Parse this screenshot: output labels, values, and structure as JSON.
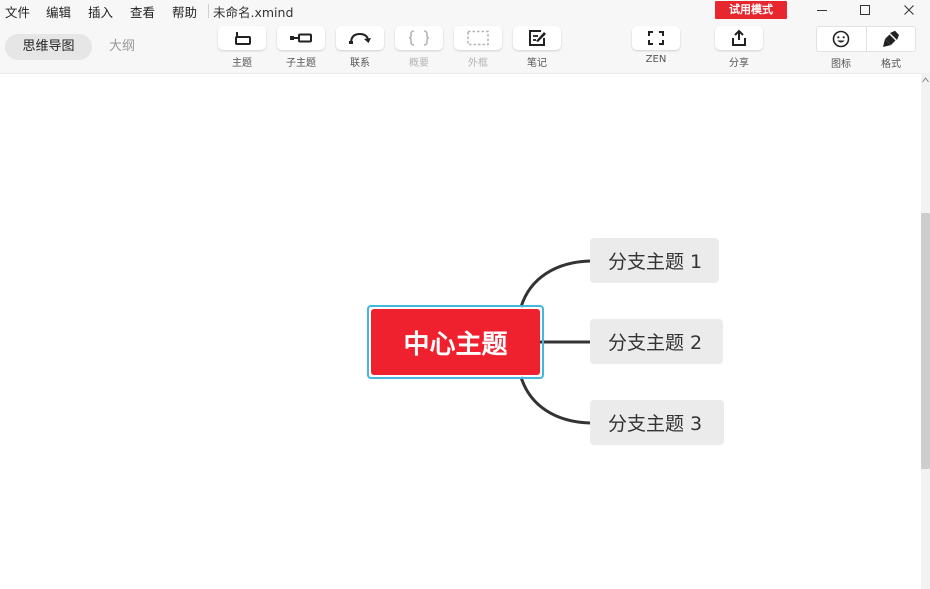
{
  "menu": [
    "文件",
    "编辑",
    "插入",
    "查看",
    "帮助"
  ],
  "file_name": "未命名.xmind",
  "trial_badge": "试用模式",
  "view_tabs": {
    "mindmap": "思维导图",
    "outline": "大纲"
  },
  "toolbar": {
    "topic": "主题",
    "subtopic": "子主题",
    "relationship": "联系",
    "summary": "概要",
    "boundary": "外框",
    "notes": "笔记",
    "zen": "ZEN",
    "share": "分享",
    "icon": "图标",
    "format": "格式"
  },
  "disabled_tools": [
    "summary",
    "boundary"
  ],
  "mindmap": {
    "central_topic": "中心主题",
    "branches": [
      "分支主题 1",
      "分支主题 2",
      "分支主题 3"
    ]
  },
  "colors": {
    "central_fill": "#f0212e",
    "selection_outline": "#45b6dd",
    "branch_fill": "#ebebeb",
    "connector": "#333333",
    "trial_badge": "#e8262d"
  }
}
